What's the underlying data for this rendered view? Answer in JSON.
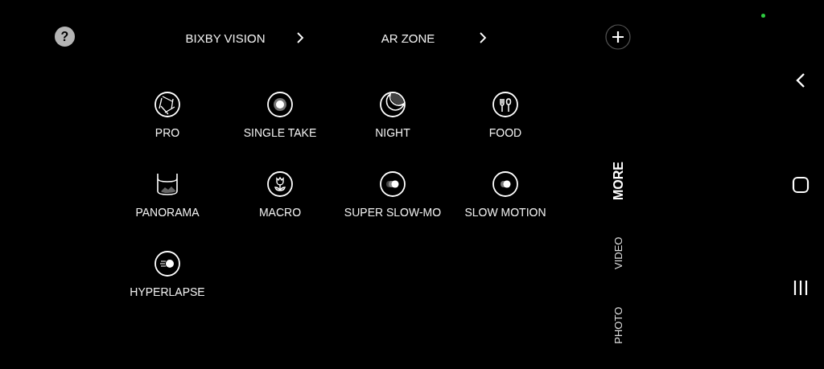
{
  "help_button": {
    "label": "?"
  },
  "top_links": [
    {
      "label": "BIXBY VISION"
    },
    {
      "label": "AR ZONE"
    }
  ],
  "modes": [
    {
      "label": "PRO"
    },
    {
      "label": "SINGLE TAKE"
    },
    {
      "label": "NIGHT"
    },
    {
      "label": "FOOD"
    },
    {
      "label": "PANORAMA"
    },
    {
      "label": "MACRO"
    },
    {
      "label": "SUPER SLOW-MO"
    },
    {
      "label": "SLOW MOTION"
    },
    {
      "label": "HYPERLAPSE"
    }
  ],
  "mode_tabs": [
    {
      "label": "MORE",
      "selected": true
    },
    {
      "label": "VIDEO",
      "selected": false
    },
    {
      "label": "PHOTO",
      "selected": false
    }
  ]
}
